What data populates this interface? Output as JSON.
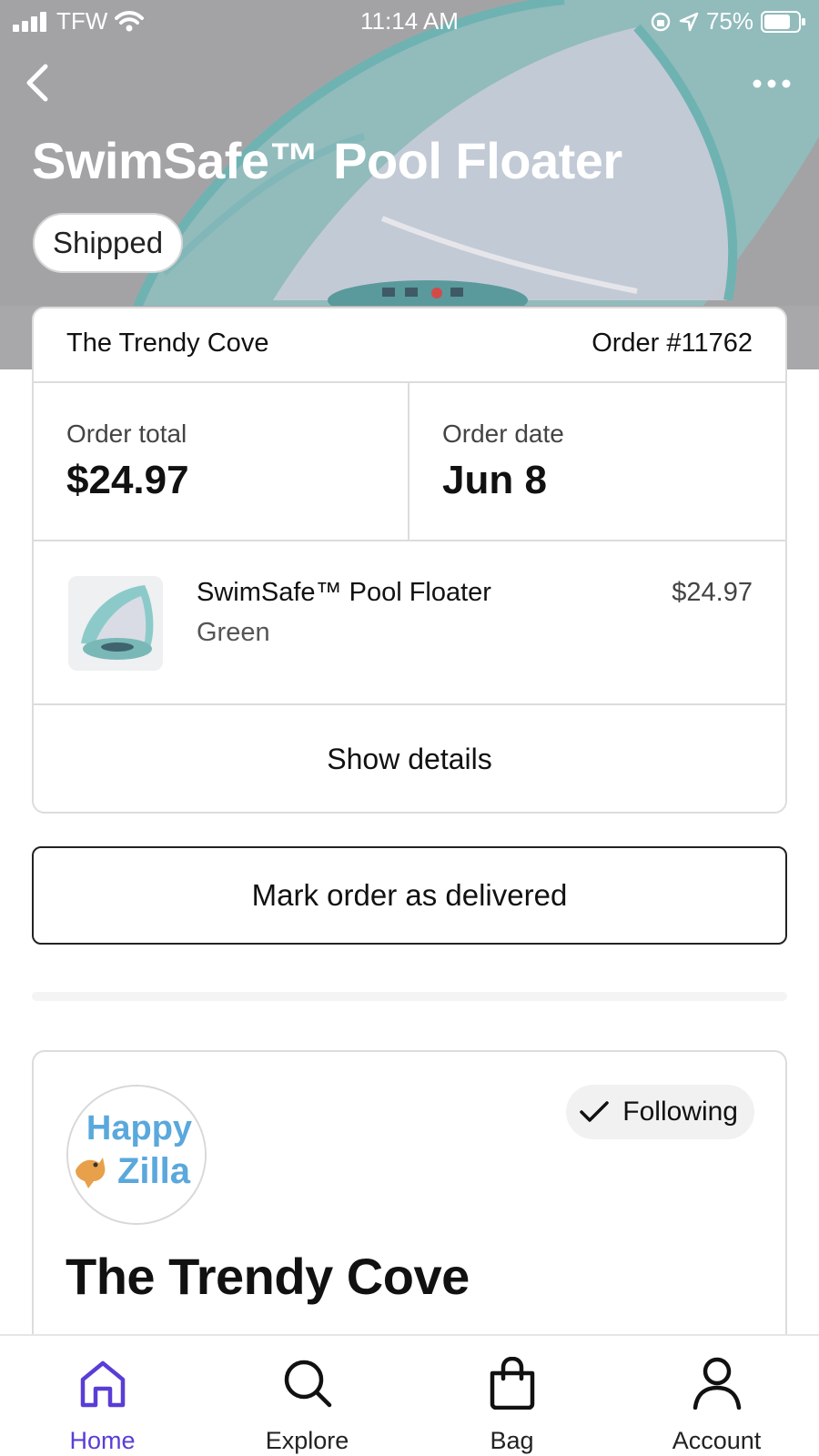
{
  "status_bar": {
    "carrier": "TFW",
    "time": "11:14 AM",
    "battery": "75%"
  },
  "header": {
    "title": "SwimSafe™ Pool Floater",
    "status_badge": "Shipped",
    "back_icon": "chevron-left-icon",
    "more_icon": "more-horizontal-icon"
  },
  "order": {
    "shop_name": "The Trendy Cove",
    "order_number": "Order #11762",
    "total_label": "Order total",
    "total_value": "$24.97",
    "date_label": "Order date",
    "date_value": "Jun 8",
    "item": {
      "name": "SwimSafe™ Pool Floater",
      "variant": "Green",
      "price": "$24.97"
    },
    "show_details_label": "Show details"
  },
  "actions": {
    "mark_delivered_label": "Mark order as delivered"
  },
  "shop_card": {
    "logo_text": [
      "Happy",
      "Zilla"
    ],
    "following_label": "Following",
    "name": "The Trendy Cove"
  },
  "tab_bar": {
    "tabs": [
      {
        "label": "Home",
        "icon": "home-icon",
        "active": true
      },
      {
        "label": "Explore",
        "icon": "search-icon",
        "active": false
      },
      {
        "label": "Bag",
        "icon": "bag-icon",
        "active": false
      },
      {
        "label": "Account",
        "icon": "user-icon",
        "active": false
      }
    ]
  },
  "colors": {
    "accent": "#5a3dd6",
    "hero_bg": "#a8a8ab"
  }
}
